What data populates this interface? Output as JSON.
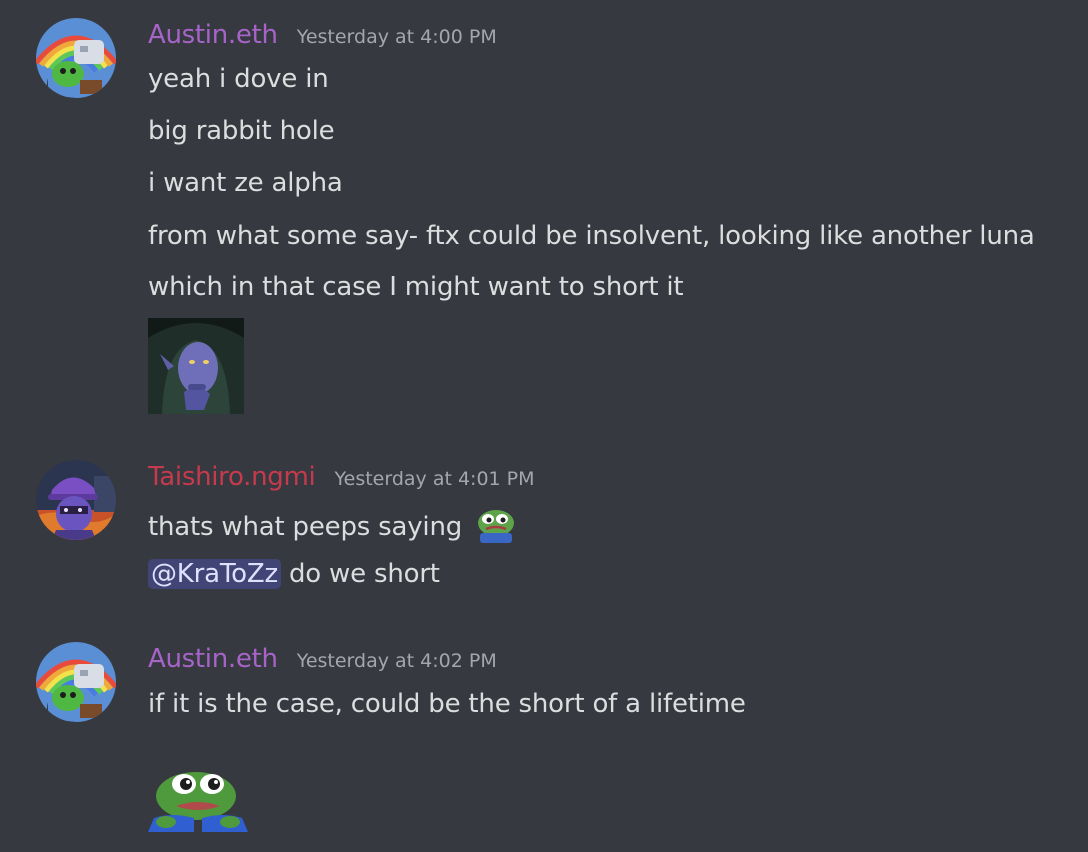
{
  "colors": {
    "background": "#36393f",
    "austin_name": "#a764c8",
    "taishiro_name": "#c53a4c",
    "mention_bg": "#4a4e86"
  },
  "messages": [
    {
      "author": "Austin.eth",
      "timestamp": "Yesterday at 4:00 PM",
      "avatar_icon": "goblin-rainbow-avatar",
      "lines": [
        "yeah i dove in",
        "big rabbit hole",
        "i want ze alpha",
        "from what some say- ftx could be insolvent, looking like another luna",
        "which in that case I might want to short it"
      ],
      "attachment": "hooded-figure-image"
    },
    {
      "author": "Taishiro.ngmi",
      "timestamp": "Yesterday at 4:01 PM",
      "avatar_icon": "purple-hat-character-avatar",
      "lines": [
        "thats what peeps saying",
        "do we short"
      ],
      "inline_emoji": "pepe-emoji",
      "mention": "@KraToZz"
    },
    {
      "author": "Austin.eth",
      "timestamp": "Yesterday at 4:02 PM",
      "avatar_icon": "goblin-rainbow-avatar",
      "lines": [
        "if it is the case, could be the short of a lifetime"
      ],
      "attachment": "pepe-sticker"
    }
  ]
}
